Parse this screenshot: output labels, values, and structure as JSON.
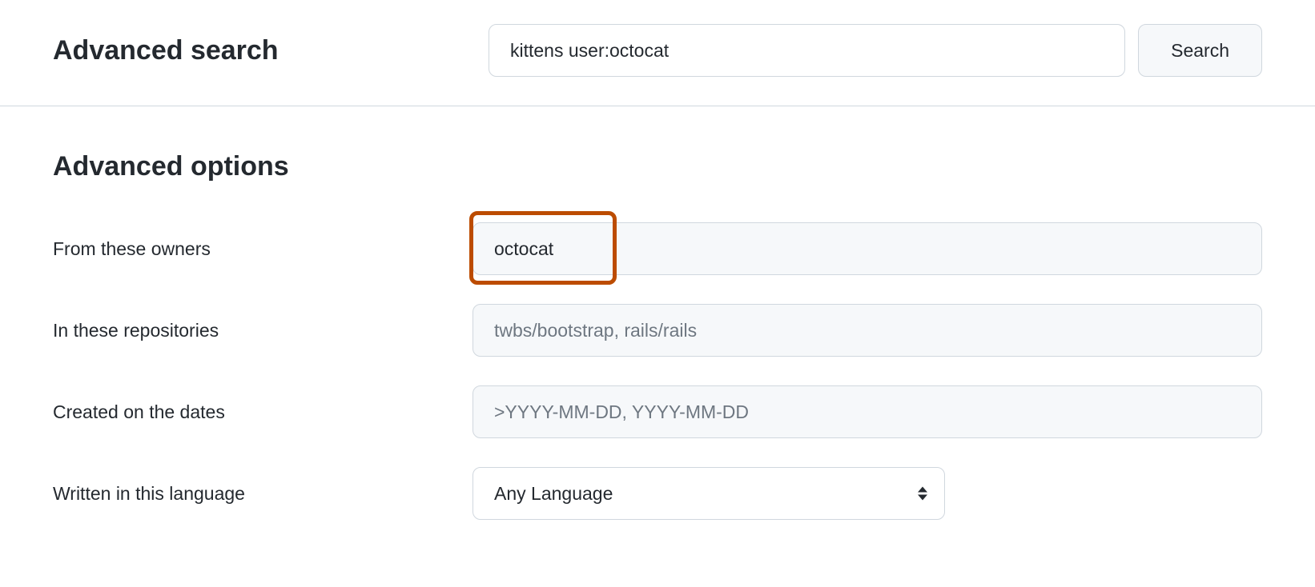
{
  "header": {
    "title": "Advanced search",
    "search_value": "kittens user:octocat",
    "search_button": "Search"
  },
  "options": {
    "section_title": "Advanced options",
    "fields": {
      "owners": {
        "label": "From these owners",
        "value": "octocat",
        "highlighted": true
      },
      "repositories": {
        "label": "In these repositories",
        "value": "",
        "placeholder": "twbs/bootstrap, rails/rails"
      },
      "created": {
        "label": "Created on the dates",
        "value": "",
        "placeholder": ">YYYY-MM-DD, YYYY-MM-DD"
      },
      "language": {
        "label": "Written in this language",
        "selected": "Any Language"
      }
    }
  }
}
